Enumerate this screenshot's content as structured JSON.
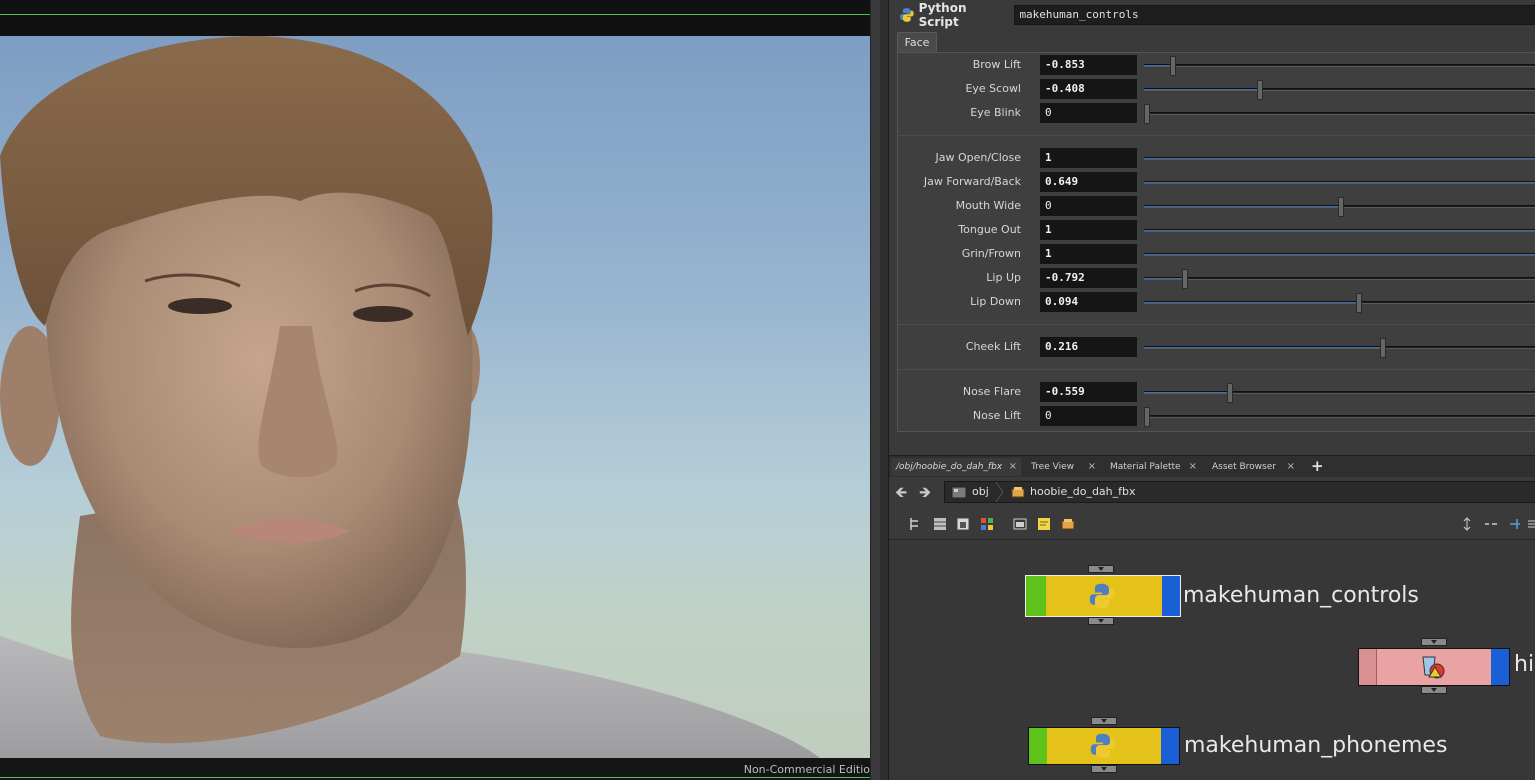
{
  "viewport": {
    "watermark": "Non-Commercial Editio"
  },
  "parameters": {
    "op_type": "Python Script",
    "op_name": "makehuman_controls",
    "tab": "Face",
    "rows": [
      {
        "label": "Brow Lift",
        "value": "-0.853",
        "fraction": 0.074,
        "modified": true
      },
      {
        "label": "Eye Scowl",
        "value": "-0.408",
        "fraction": 0.296,
        "modified": true
      },
      {
        "label": "Eye Blink",
        "value": "0",
        "fraction": 0.0,
        "modified": false
      },
      {
        "label": "Jaw Open/Close",
        "value": "1",
        "fraction": 1.0,
        "modified": true
      },
      {
        "label": "Jaw Forward/Back",
        "value": "0.649",
        "fraction": 1.0,
        "modified": true
      },
      {
        "label": "Mouth Wide",
        "value": "0",
        "fraction": 0.5,
        "modified": false
      },
      {
        "label": "Tongue Out",
        "value": "1",
        "fraction": 1.0,
        "modified": true
      },
      {
        "label": "Grin/Frown",
        "value": "1",
        "fraction": 1.0,
        "modified": true
      },
      {
        "label": "Lip Up",
        "value": "-0.792",
        "fraction": 0.104,
        "modified": true
      },
      {
        "label": "Lip Down",
        "value": "0.094",
        "fraction": 0.547,
        "modified": true
      },
      {
        "label": "Cheek Lift",
        "value": "0.216",
        "fraction": 0.608,
        "modified": true
      },
      {
        "label": "Nose Flare",
        "value": "-0.559",
        "fraction": 0.22,
        "modified": true
      },
      {
        "label": "Nose Lift",
        "value": "0",
        "fraction": 0.0,
        "modified": false
      }
    ]
  },
  "network": {
    "tabs": [
      {
        "label": "/obj/hoobie_do_dah_fbx",
        "active": true
      },
      {
        "label": "Tree View",
        "active": false
      },
      {
        "label": "Material Palette",
        "active": false
      },
      {
        "label": "Asset Browser",
        "active": false
      }
    ],
    "close_glyph": "×",
    "add_glyph": "+",
    "back_glyph": "🡸",
    "forward_glyph": "🡺",
    "breadcrumbs": [
      "obj",
      "hoobie_do_dah_fbx"
    ],
    "nodes": [
      {
        "label": "makehuman_controls",
        "color": "#e5c21a"
      },
      {
        "label": "hi",
        "color": "#eaa3a3"
      },
      {
        "label": "makehuman_phonemes",
        "color": "#e5c21a"
      }
    ]
  },
  "colors": {
    "display_flag": "#1a5fd6",
    "bypass_flag": "#5fc21a",
    "slider_fill": "#3b6fb5"
  }
}
